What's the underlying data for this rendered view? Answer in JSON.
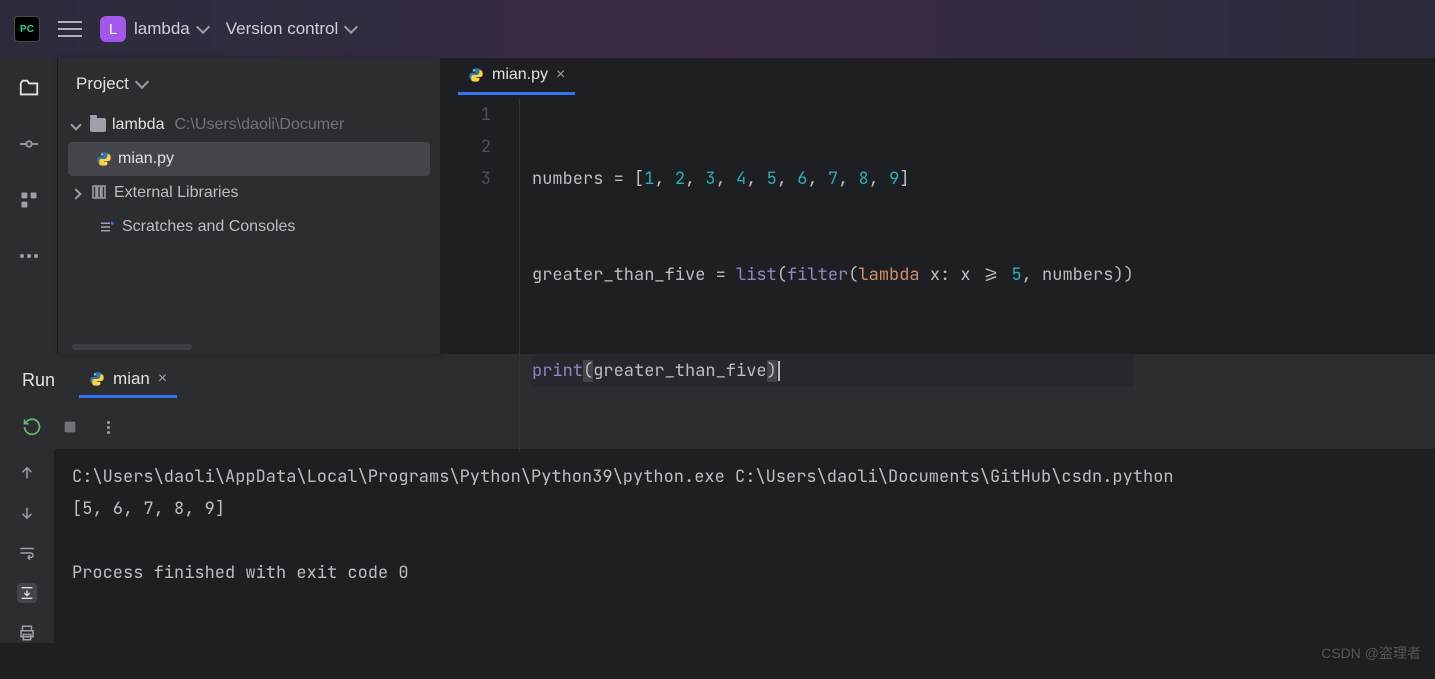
{
  "titlebar": {
    "project_letter": "L",
    "project_name": "lambda",
    "version_control": "Version control"
  },
  "project_panel": {
    "title": "Project",
    "root_name": "lambda",
    "root_path": "C:\\Users\\daoli\\Documer",
    "file_name": "mian.py",
    "external_libraries": "External Libraries",
    "scratches": "Scratches and Consoles"
  },
  "editor": {
    "tab_label": "mian.py",
    "lines": [
      "1",
      "2",
      "3"
    ]
  },
  "code": {
    "l1_a": "numbers = [",
    "l1_n1": "1",
    "l1_c": ", ",
    "l1_n2": "2",
    "l1_n3": "3",
    "l1_n4": "4",
    "l1_n5": "5",
    "l1_n6": "6",
    "l1_n7": "7",
    "l1_n8": "8",
    "l1_n9": "9",
    "l1_z": "]",
    "l2_a": "greater_than_five = ",
    "l2_list": "list",
    "l2_p1": "(",
    "l2_filter": "filter",
    "l2_p2": "(",
    "l2_lambda": "lambda",
    "l2_b": " x: x >= ",
    "l2_five": "5",
    "l2_c": ", numbers))",
    "l3_print": "print",
    "l3_p1": "(",
    "l3_arg": "greater_than_five",
    "l3_p2": ")"
  },
  "run": {
    "title": "Run",
    "tab_label": "mian",
    "output_line1": "C:\\Users\\daoli\\AppData\\Local\\Programs\\Python\\Python39\\python.exe C:\\Users\\daoli\\Documents\\GitHub\\csdn.python",
    "output_line2": "[5, 6, 7, 8, 9]",
    "output_exit": "Process finished with exit code 0"
  },
  "watermark": "CSDN @盗理者"
}
